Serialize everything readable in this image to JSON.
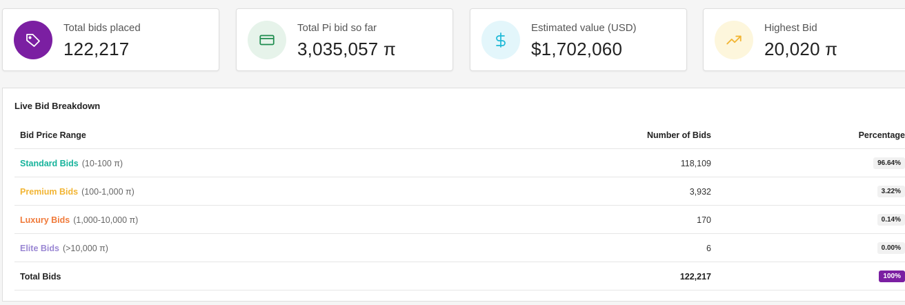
{
  "colors": {
    "tag_bg": "#7b1fa2",
    "card_bg": "#e6f3ea",
    "dollar_bg": "#e3f6fb",
    "trend_bg": "#fdf6dc",
    "standard": "#16b39b",
    "premium": "#f2b534",
    "luxury": "#f07a3a",
    "elite": "#9a87d3",
    "total_badge": "#7b1fa2"
  },
  "stats": [
    {
      "icon": "tag-icon",
      "label": "Total bids placed",
      "value": "122,217"
    },
    {
      "icon": "credit-card-icon",
      "label": "Total Pi bid so far",
      "value": "3,035,057 π"
    },
    {
      "icon": "dollar-icon",
      "label": "Estimated value (USD)",
      "value": "$1,702,060"
    },
    {
      "icon": "trending-up-icon",
      "label": "Highest Bid",
      "value": "20,020 π"
    }
  ],
  "breakdown": {
    "title": "Live Bid Breakdown",
    "headers": {
      "range": "Bid Price Range",
      "count": "Number of Bids",
      "percentage": "Percentage"
    },
    "rows": [
      {
        "tier": "Standard Bids",
        "range": "(10-100 π)",
        "count": "118,109",
        "percentage": "96.64%"
      },
      {
        "tier": "Premium Bids",
        "range": "(100-1,000 π)",
        "count": "3,932",
        "percentage": "3.22%"
      },
      {
        "tier": "Luxury Bids",
        "range": "(1,000-10,000 π)",
        "count": "170",
        "percentage": "0.14%"
      },
      {
        "tier": "Elite Bids",
        "range": "(>10,000 π)",
        "count": "6",
        "percentage": "0.00%"
      }
    ],
    "total": {
      "label": "Total Bids",
      "count": "122,217",
      "percentage": "100%"
    }
  }
}
